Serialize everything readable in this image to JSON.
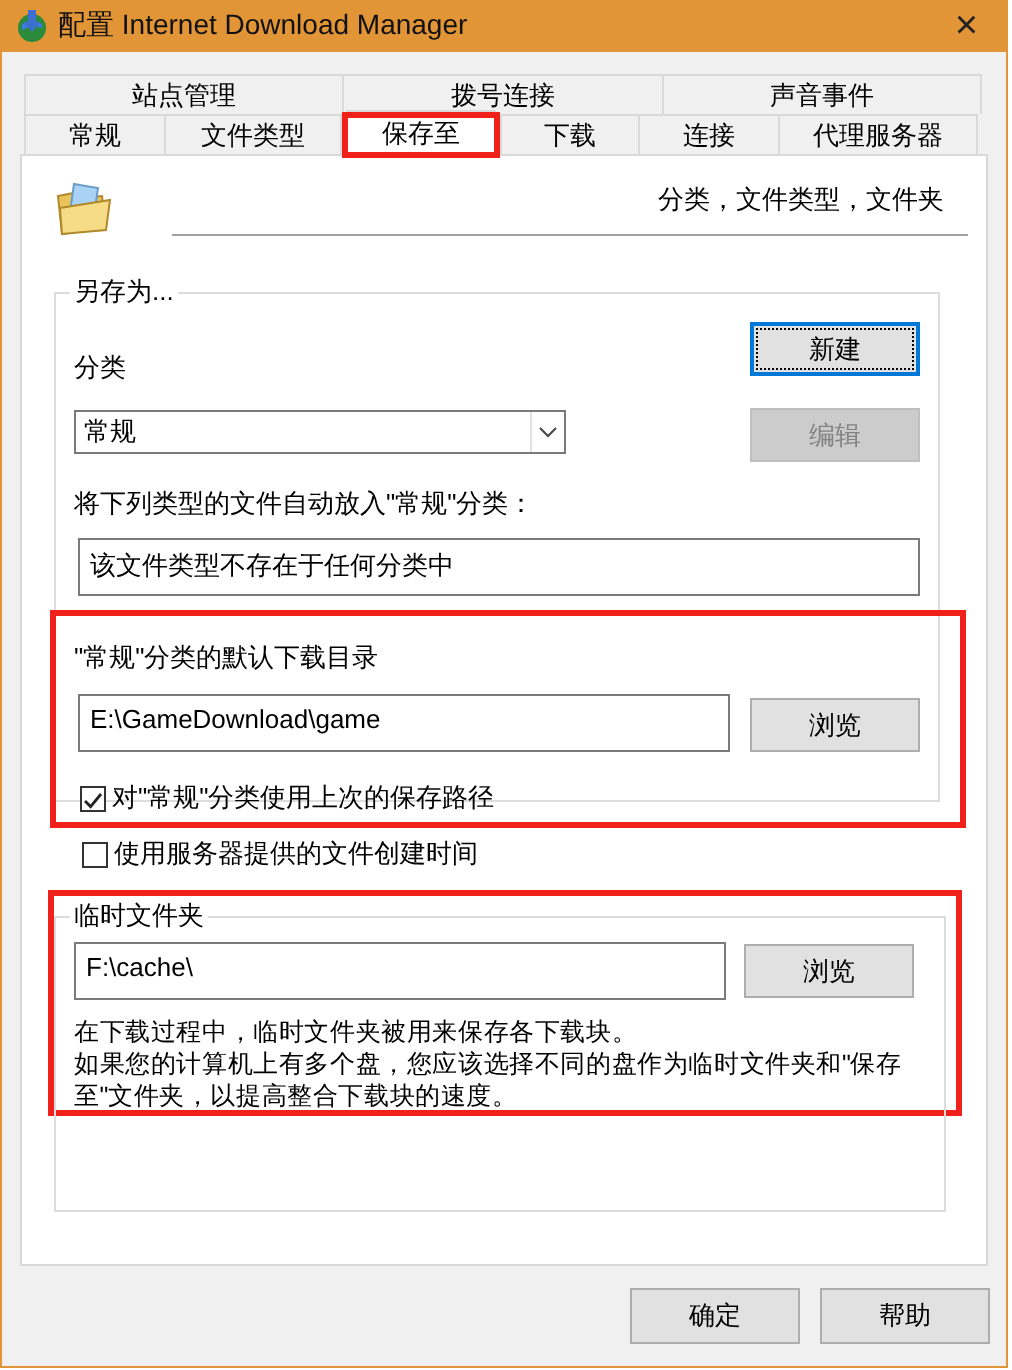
{
  "window": {
    "title": "配置 Internet Download Manager",
    "close": "×"
  },
  "tab_rows": [
    [
      {
        "label": "站点管理",
        "selected": false,
        "highlighted": false
      },
      {
        "label": "拨号连接",
        "selected": false,
        "highlighted": false
      },
      {
        "label": "声音事件",
        "selected": false,
        "highlighted": false
      }
    ],
    [
      {
        "label": "常规",
        "selected": false,
        "highlighted": false
      },
      {
        "label": "文件类型",
        "selected": false,
        "highlighted": false
      },
      {
        "label": "保存至",
        "selected": true,
        "highlighted": true
      },
      {
        "label": "下载",
        "selected": false,
        "highlighted": false
      },
      {
        "label": "连接",
        "selected": false,
        "highlighted": false
      },
      {
        "label": "代理服务器",
        "selected": false,
        "highlighted": false
      }
    ]
  ],
  "header": "分类，文件类型，文件夹",
  "save_as": {
    "title": "另存为...",
    "category_label": "分类",
    "category": "常规",
    "new_button": {
      "label": "新建",
      "disabled": false
    },
    "edit_button": {
      "label": "编辑",
      "disabled": true
    },
    "auto_label": "将下列类型的文件自动放入\"常规\"分类：",
    "types_field": "该文件类型不存在于任何分类中",
    "default_dir": {
      "highlighted": true,
      "label": "\"常规\"分类的默认下载目录",
      "path": "E:\\GameDownload\\game",
      "browse": "浏览",
      "use_last": {
        "label": "对\"常规\"分类使用上次的保存路径",
        "checked": true
      }
    }
  },
  "server_time": {
    "label": "使用服务器提供的文件创建时间",
    "checked": false
  },
  "temp_folder": {
    "highlighted": true,
    "title": "临时文件夹",
    "path": "F:\\cache\\",
    "browse": "浏览",
    "note_lines": [
      "在下载过程中，临时文件夹被用来保存各下载块。",
      "如果您的计算机上有多个盘，您应该选择不同的盘作为临时文件夹和\"保存至\"文件夹，以提高整合下载块的速度。"
    ]
  },
  "buttons": [
    "确定",
    "帮助"
  ]
}
